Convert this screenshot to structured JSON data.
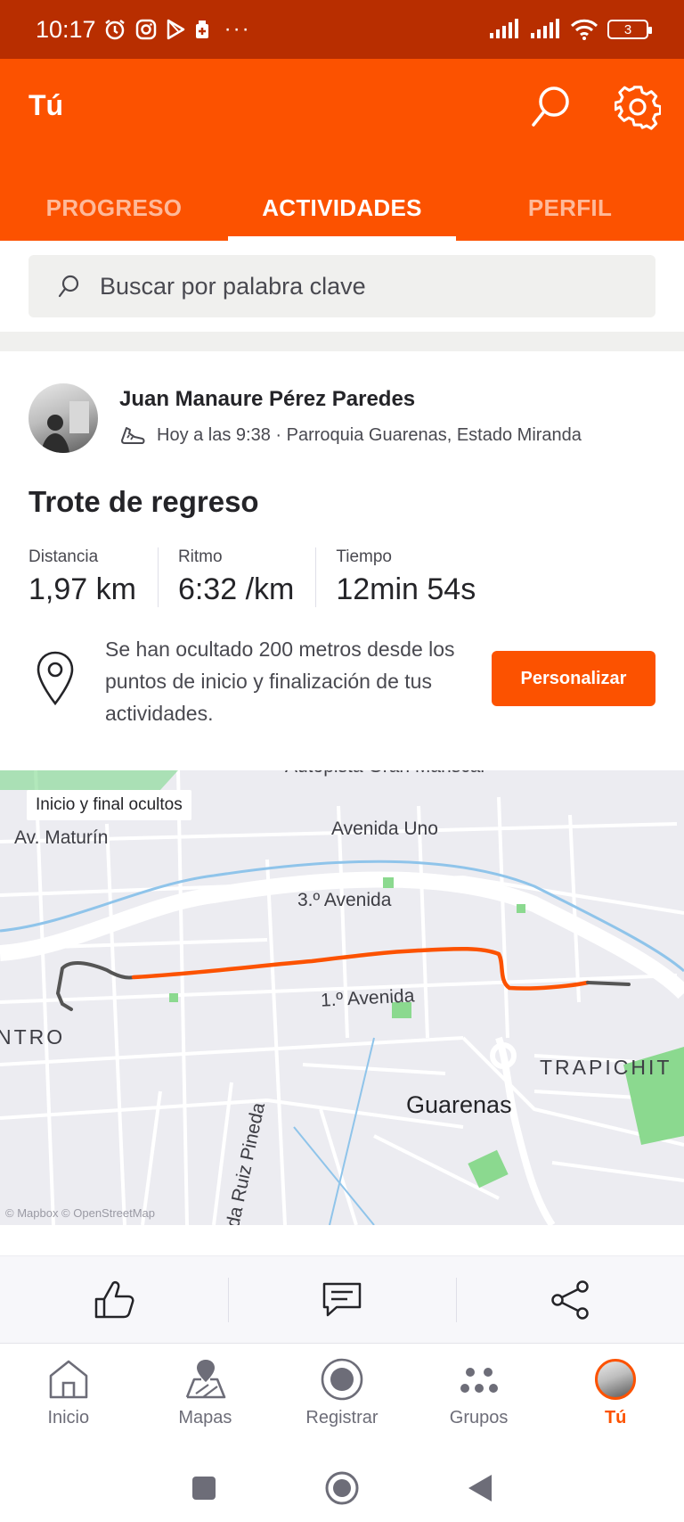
{
  "status_bar": {
    "time": "10:17",
    "battery": "3"
  },
  "header": {
    "title": "Tú"
  },
  "tabs": [
    {
      "label": "PROGRESO",
      "active": false
    },
    {
      "label": "ACTIVIDADES",
      "active": true
    },
    {
      "label": "PERFIL",
      "active": false
    }
  ],
  "search": {
    "placeholder": "Buscar por palabra clave"
  },
  "activity": {
    "athlete": "Juan Manaure Pérez Paredes",
    "meta": "Hoy a las 9:38 · Parroquia Guarenas, Estado Miranda",
    "title": "Trote de regreso",
    "stats": [
      {
        "label": "Distancia",
        "value": "1,97 km"
      },
      {
        "label": "Ritmo",
        "value": "6:32 /km"
      },
      {
        "label": "Tiempo",
        "value": "12min 54s"
      }
    ],
    "privacy_notice": "Se han ocultado 200 metros desde los puntos de inicio y finalización de tus actividades.",
    "customize_button": "Personalizar"
  },
  "map": {
    "badge": "Inicio y final ocultos",
    "labels": {
      "autopista": "Autopista Gran Mariscal",
      "maturin": "Av. Maturín",
      "avenida_uno": "Avenida Uno",
      "tercera": "3.º Avenida",
      "primera": "1.º Avenida",
      "centro": "NTRO",
      "trapichito": "TRAPICHIT",
      "guarenas": "Guarenas",
      "ruiz_pineda": "da Ruiz Pineda"
    },
    "attribution": "© Mapbox © OpenStreetMap",
    "route_color": "#fc5200",
    "hidden_color": "#555555"
  },
  "bottom_nav": [
    {
      "label": "Inicio",
      "icon": "home-icon",
      "active": false
    },
    {
      "label": "Mapas",
      "icon": "map-icon",
      "active": false
    },
    {
      "label": "Registrar",
      "icon": "record-icon",
      "active": false
    },
    {
      "label": "Grupos",
      "icon": "groups-icon",
      "active": false
    },
    {
      "label": "Tú",
      "icon": "avatar",
      "active": true
    }
  ],
  "colors": {
    "brand": "#fc5200",
    "status_bar": "#b82e00"
  }
}
